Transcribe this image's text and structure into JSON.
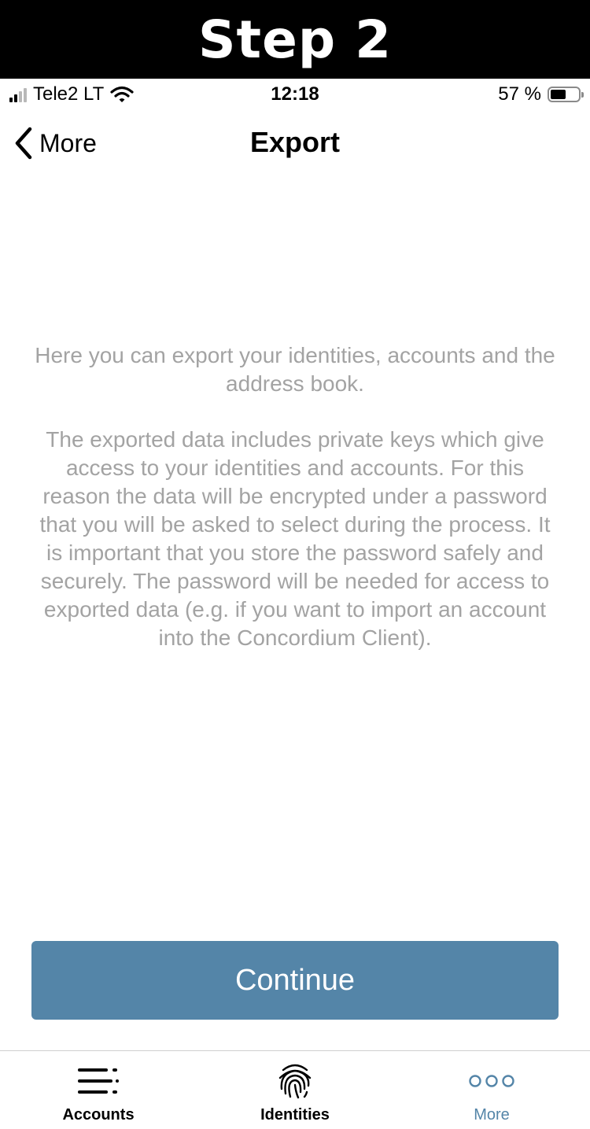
{
  "banner": {
    "text": "Step 2"
  },
  "status_bar": {
    "carrier": "Tele2 LT",
    "time": "12:18",
    "battery_text": "57 %",
    "battery_level": 0.57
  },
  "nav": {
    "back_label": "More",
    "title": "Export"
  },
  "body": {
    "paragraph1": "Here you can export your identities, accounts and the address book.",
    "paragraph2": "The exported data includes private keys which give access to your identities and accounts. For this reason the data will be encrypted under a password that you will be asked to select during the process. It is important that you store the password safely and securely. The password will be needed for access to exported data (e.g. if you want to import an account into the Concordium Client)."
  },
  "continue_button": {
    "label": "Continue"
  },
  "tab_bar": {
    "tabs": [
      {
        "label": "Accounts",
        "icon": "accounts-list-icon",
        "active": false
      },
      {
        "label": "Identities",
        "icon": "fingerprint-icon",
        "active": false
      },
      {
        "label": "More",
        "icon": "more-dots-icon",
        "active": true
      }
    ]
  },
  "colors": {
    "accent": "#5485a8",
    "body_text": "#a3a3a3",
    "banner_bg": "#000000"
  }
}
